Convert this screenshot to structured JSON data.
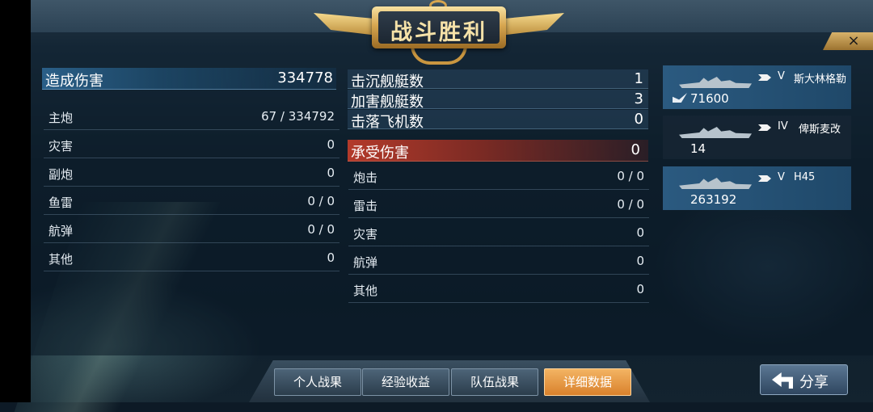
{
  "title": "战斗胜利",
  "close_icon": "×",
  "damage_dealt": {
    "header_label": "造成伤害",
    "header_value": "334778",
    "rows": [
      {
        "label": "主炮",
        "value": "67 / 334792"
      },
      {
        "label": "灾害",
        "value": "0"
      },
      {
        "label": "副炮",
        "value": "0"
      },
      {
        "label": "鱼雷",
        "value": "0 / 0"
      },
      {
        "label": "航弹",
        "value": "0 / 0"
      },
      {
        "label": "其他",
        "value": "0"
      }
    ]
  },
  "kills": [
    {
      "label": "击沉舰艇数",
      "value": "1"
    },
    {
      "label": "加害舰艇数",
      "value": "3"
    },
    {
      "label": "击落飞机数",
      "value": "0"
    }
  ],
  "damage_taken": {
    "header_label": "承受伤害",
    "header_value": "0",
    "rows": [
      {
        "label": "炮击",
        "value": "0 / 0"
      },
      {
        "label": "雷击",
        "value": "0 / 0"
      },
      {
        "label": "灾害",
        "value": "0"
      },
      {
        "label": "航弹",
        "value": "0"
      },
      {
        "label": "其他",
        "value": "0"
      }
    ]
  },
  "ships": [
    {
      "tier": "V",
      "name": "斯大林格勒",
      "value": "71600",
      "icon": "sunk-ship-icon"
    },
    {
      "tier": "IV",
      "name": "俾斯麦改",
      "value": "14"
    },
    {
      "tier": "V",
      "name": "H45",
      "value": "263192"
    }
  ],
  "tabs": [
    {
      "label": "个人战果",
      "active": false
    },
    {
      "label": "经验收益",
      "active": false
    },
    {
      "label": "队伍战果",
      "active": false
    },
    {
      "label": "详细数据",
      "active": true
    }
  ],
  "share_label": "分享",
  "colors": {
    "active_tab": "#e8953a",
    "highlight_card": "#2b5a80",
    "damage_taken_header": "#b33a2a"
  }
}
